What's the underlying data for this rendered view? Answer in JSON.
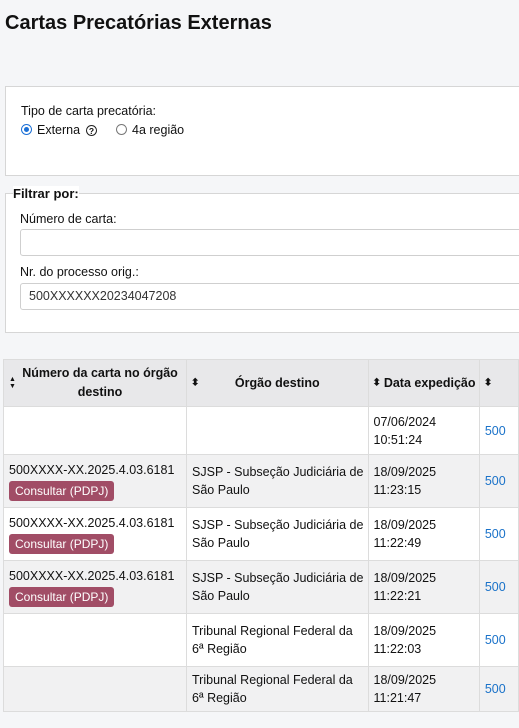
{
  "page": {
    "title": "Cartas Precatórias Externas"
  },
  "tipo": {
    "label": "Tipo de carta precatória:",
    "options": [
      {
        "label": "Externa",
        "checked": true
      },
      {
        "label": "4a região",
        "checked": false
      }
    ],
    "help_glyph": "?"
  },
  "filtro": {
    "legend": "Filtrar por:",
    "numero_carta": {
      "label": "Número de carta:",
      "value": ""
    },
    "processo": {
      "label": "Nr. do processo orig.:",
      "value": "500XXXXXX20234047208"
    }
  },
  "table": {
    "columns": [
      "Número da carta no órgão destino",
      "Órgão destino",
      "Data expedição"
    ],
    "consult_label": "Consultar (PDPJ)",
    "rows": [
      {
        "numero": "",
        "orgao": "",
        "data": "07/06/2024 10:51:24",
        "link": "500"
      },
      {
        "numero": "500XXXX-XX.2025.4.03.6181",
        "orgao": "SJSP - Subseção Judiciária de São Paulo",
        "data": "18/09/2025 11:23:15",
        "link": "500"
      },
      {
        "numero": "500XXXX-XX.2025.4.03.6181",
        "orgao": "SJSP - Subseção Judiciária de São Paulo",
        "data": "18/09/2025 11:22:49",
        "link": "500"
      },
      {
        "numero": "500XXXX-XX.2025.4.03.6181",
        "orgao": "SJSP - Subseção Judiciária de São Paulo",
        "data": "18/09/2025 11:22:21",
        "link": "500"
      },
      {
        "numero": "",
        "orgao": "Tribunal Regional Federal da 6ª Região",
        "data": "18/09/2025 11:22:03",
        "link": "500"
      },
      {
        "numero": "",
        "orgao": "Tribunal Regional Federal da 6ª Região",
        "data": "18/09/2025 11:21:47",
        "link": "500"
      }
    ]
  }
}
